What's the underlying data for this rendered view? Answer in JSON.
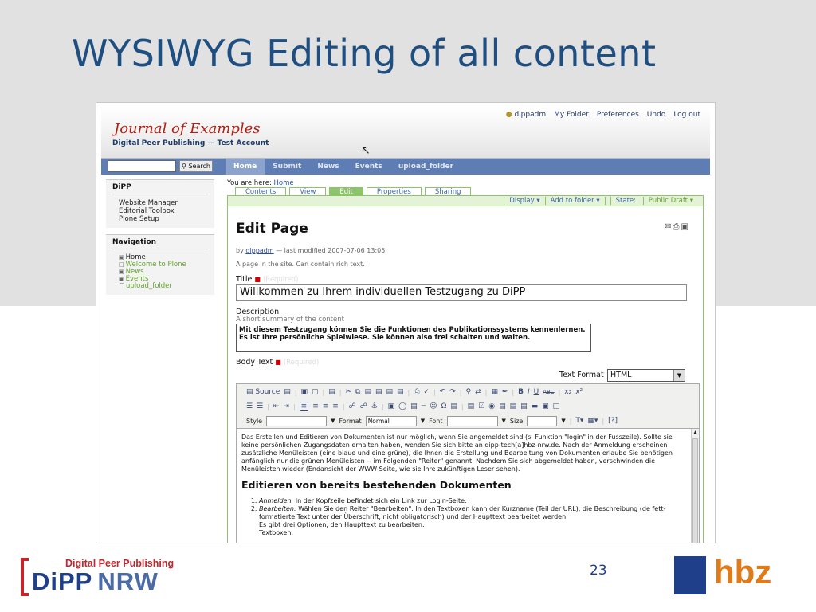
{
  "slide": {
    "title": "WYSIWYG Editing of all content",
    "page_number": "23"
  },
  "site": {
    "title": "Journal of Examples",
    "subtitle": "Digital Peer Publishing — Test Account",
    "personal_bar": [
      "dippadm",
      "My Folder",
      "Preferences",
      "Undo",
      "Log out"
    ]
  },
  "search": {
    "value": "",
    "button_label": "Search"
  },
  "global_nav": [
    "Home",
    "Submit",
    "News",
    "Events",
    "upload_folder"
  ],
  "left": {
    "dipp_portlet": {
      "title": "DiPP",
      "items": [
        "Website Manager",
        "Editorial Toolbox",
        "Plone Setup"
      ]
    },
    "navigation": {
      "title": "Navigation",
      "items": [
        "Home",
        "Welcome to Plone",
        "News",
        "Events",
        "upload_folder"
      ]
    }
  },
  "breadcrumb": {
    "prefix": "You are here:",
    "link": "Home"
  },
  "content_tabs": [
    "Contents",
    "View",
    "Edit",
    "Properties",
    "Sharing"
  ],
  "content_actions": [
    "Display ▾",
    "Add to folder ▾",
    "State:",
    "Public Draft ▾"
  ],
  "edit": {
    "heading": "Edit Page",
    "byline_prefix": "by",
    "author": "dippadm",
    "byline_suffix": "— last modified 2007-07-06 13:05",
    "type_description": "A page in the site. Can contain rich text.",
    "title_label": "Title",
    "required": "(Required)",
    "title_value": "Willkommen zu Ihrem individuellen Testzugang zu DiPP",
    "description_label": "Description",
    "description_help": "A short summary of the content",
    "description_value": "Mit diesem Testzugang können Sie die Funktionen des Publikationssystems kennenlernen. Es ist Ihre persönliche Spielwiese. Sie können also frei schalten und walten.",
    "body_label": "Body Text",
    "text_format_label": "Text Format",
    "text_format_value": "HTML"
  },
  "editor": {
    "source_label": "Source",
    "style_label": "Style",
    "format_label": "Format",
    "format_value": "Normal",
    "font_label": "Font",
    "size_label": "Size",
    "intro": "Das Erstellen und Editieren von Dokumenten ist nur möglich, wenn Sie angemeldet sind (s. Funktion \"login\" in der Fusszeile). Sollte sie keine persönlichen Zugangsdaten erhalten haben, wenden Sie sich bitte an dipp-tech[a]hbz-nrw.de. Nach der Anmeldung erscheinen zusätzliche Menüleisten (eine blaue und eine grüne), die Ihnen die Erstellung und Bearbeitung von Dokumenten erlaube Sie benötigen anfänglich nur die grünen Menüleisten -- im Folgenden \"Reiter\" genannt. Nachdem Sie sich abgemeldet haben, verschwinden die Menüleisten wieder (Endansicht der WWW-Seite, wie sie Ihre zukünftigen Leser sehen).",
    "heading": "Editieren von bereits bestehenden Dokumenten",
    "item1_label": "Anmelden:",
    "item1_text": "In der Kopfzeile befindet sich ein Link zur",
    "item1_link": "Login-Seite",
    "item2_label": "Bearbeiten:",
    "item2_text": "Wählen Sie den Reiter \"Bearbeiten\". In den Textboxen kann der Kurzname (Teil der URL), die Beschreibung (de fett-formatierte Text unter der Überschrift, nicht obligatorisch) und der Haupttext bearbeitet werden.",
    "item2_more": "Es gibt drei Optionen, den Haupttext zu bearbeiten:",
    "item2_more2": "Textboxen:"
  },
  "footer": {
    "dipp_small": "Digital Peer Publishing",
    "dipp_big": "DiPP",
    "dipp_nrw": "NRW",
    "hbz": "hbz"
  },
  "colors": {
    "title_blue": "#1f4e80",
    "plone_green": "#8bc46a",
    "nav_blue": "#5e7db5",
    "site_red": "#b31d12",
    "hbz_orange": "#e07b1a"
  }
}
